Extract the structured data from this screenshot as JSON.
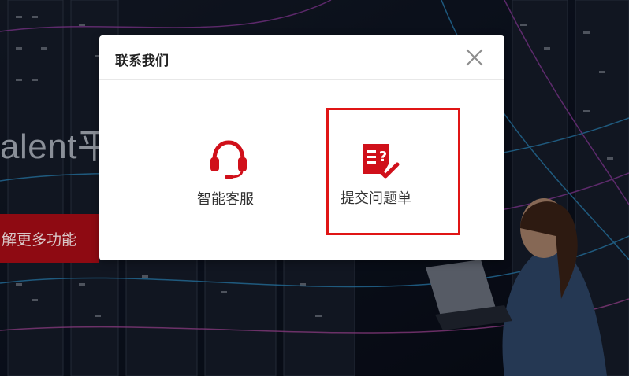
{
  "page": {
    "hero_text": "alent平",
    "hero_button_label": "解更多功能"
  },
  "modal": {
    "title": "联系我们",
    "close_icon": "close-icon",
    "options": [
      {
        "label": "智能客服",
        "icon": "headset-icon"
      },
      {
        "label": "提交问题单",
        "icon": "ticket-icon"
      }
    ]
  },
  "colors": {
    "brand_red": "#d0101a",
    "highlight_border": "#e01515"
  }
}
